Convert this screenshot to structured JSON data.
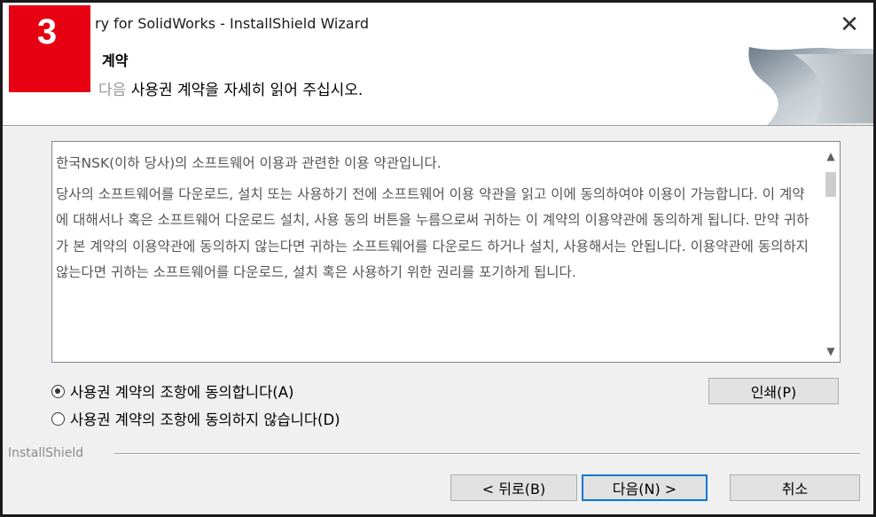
{
  "badge": {
    "number": "3",
    "color": "#e60012"
  },
  "window": {
    "title": "ry for SolidWorks - InstallShield Wizard",
    "close_icon": "close-icon",
    "close_glyph": "✕"
  },
  "header": {
    "title": "계약",
    "subtitle_prefix": "다음",
    "subtitle": "사용권 계약을 자세히 읽어 주십시오."
  },
  "license": {
    "paragraphs": [
      "한국NSK(이하 당사)의 소프트웨어 이용과 관련한 이용 약관입니다.",
      "당사의 소프트웨어를 다운로드, 설치 또는 사용하기 전에 소프트웨어 이용 약관을 읽고 이에 동의하여야 이용이 가능합니다. 이 계약에 대해서나 혹은 소프트웨어 다운로드 설치, 사용 동의 버튼을 누름으로써 귀하는 이 계약의 이용약관에 동의하게 됩니다. 만약 귀하가 본 계약의 이용약관에 동의하지 않는다면 귀하는 소프트웨어를 다운로드 하거나 설치, 사용해서는 안됩니다. 이용약관에 동의하지 않는다면 귀하는 소프트웨어를 다운로드, 설치 혹은 사용하기 위한 권리를 포기하게 됩니다."
    ],
    "scroll_up_glyph": "▲",
    "scroll_down_glyph": "▼"
  },
  "options": {
    "accept_label": "사용권 계약의 조항에 동의합니다(A)",
    "decline_label": "사용권 계약의 조항에 동의하지 않습니다(D)",
    "selected": "accept"
  },
  "buttons": {
    "print": "인쇄(P)",
    "back": "< 뒤로(B)",
    "next": "다음(N) >",
    "cancel": "취소"
  },
  "footer": {
    "brand": "InstallShield"
  }
}
